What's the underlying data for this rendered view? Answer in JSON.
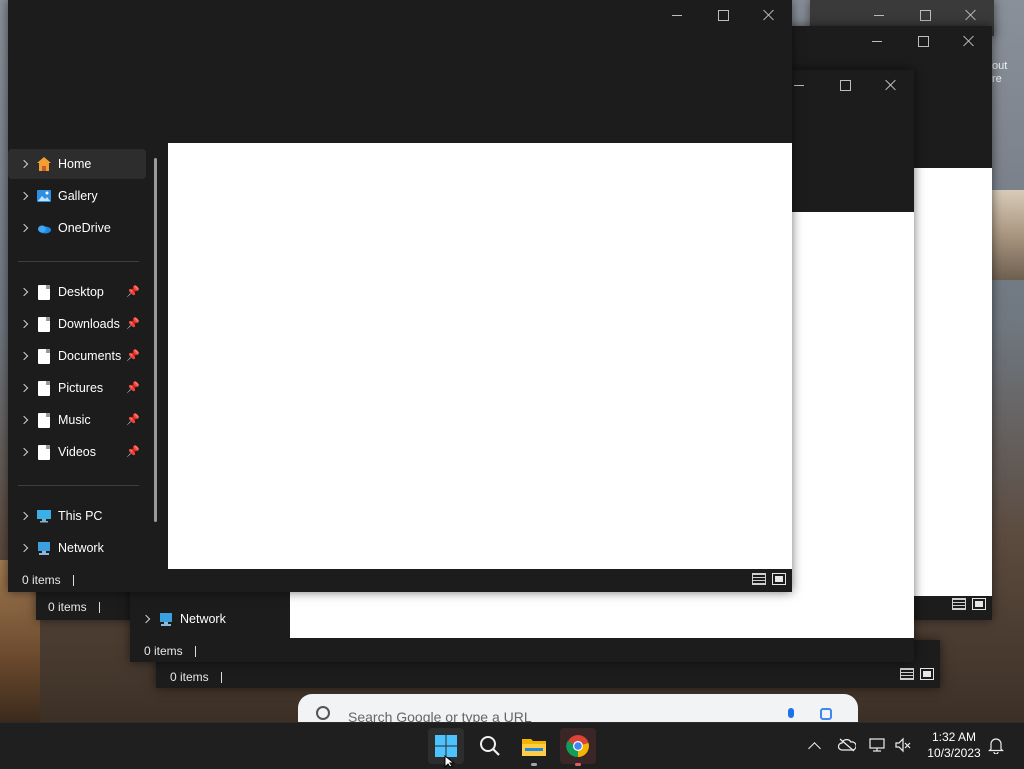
{
  "desktop": {
    "partial_text": [
      "out",
      "re"
    ]
  },
  "windows": {
    "front": {
      "nav": {
        "groups": [
          [
            {
              "label": "Home",
              "icon": "home-icon",
              "selected": true
            },
            {
              "label": "Gallery",
              "icon": "gallery-icon"
            },
            {
              "label": "OneDrive",
              "icon": "onedrive-icon"
            }
          ],
          [
            {
              "label": "Desktop",
              "icon": "document-icon",
              "pinned": true
            },
            {
              "label": "Downloads",
              "icon": "document-icon",
              "pinned": true
            },
            {
              "label": "Documents",
              "icon": "document-icon",
              "pinned": true
            },
            {
              "label": "Pictures",
              "icon": "document-icon",
              "pinned": true
            },
            {
              "label": "Music",
              "icon": "document-icon",
              "pinned": true
            },
            {
              "label": "Videos",
              "icon": "document-icon",
              "pinned": true
            }
          ],
          [
            {
              "label": "This PC",
              "icon": "this-pc-icon"
            },
            {
              "label": "Network",
              "icon": "network-icon"
            }
          ]
        ]
      },
      "status": "0 items"
    },
    "back1": {
      "nav_label": "Network",
      "status": "0 items"
    },
    "back2": {
      "status": "0 items"
    },
    "back3": {
      "status": "0 items"
    }
  },
  "browser": {
    "search_placeholder": "Search Google or type a URL"
  },
  "taskbar": {
    "apps": [
      "start-icon",
      "search-icon",
      "file-explorer-icon",
      "chrome-icon"
    ],
    "clock": {
      "time": "1:32 AM",
      "date": "10/3/2023"
    }
  },
  "colors": {
    "accent": "#0067c0",
    "window_bg": "#1c1c1c",
    "taskbar_bg": "#1f1f1f"
  }
}
